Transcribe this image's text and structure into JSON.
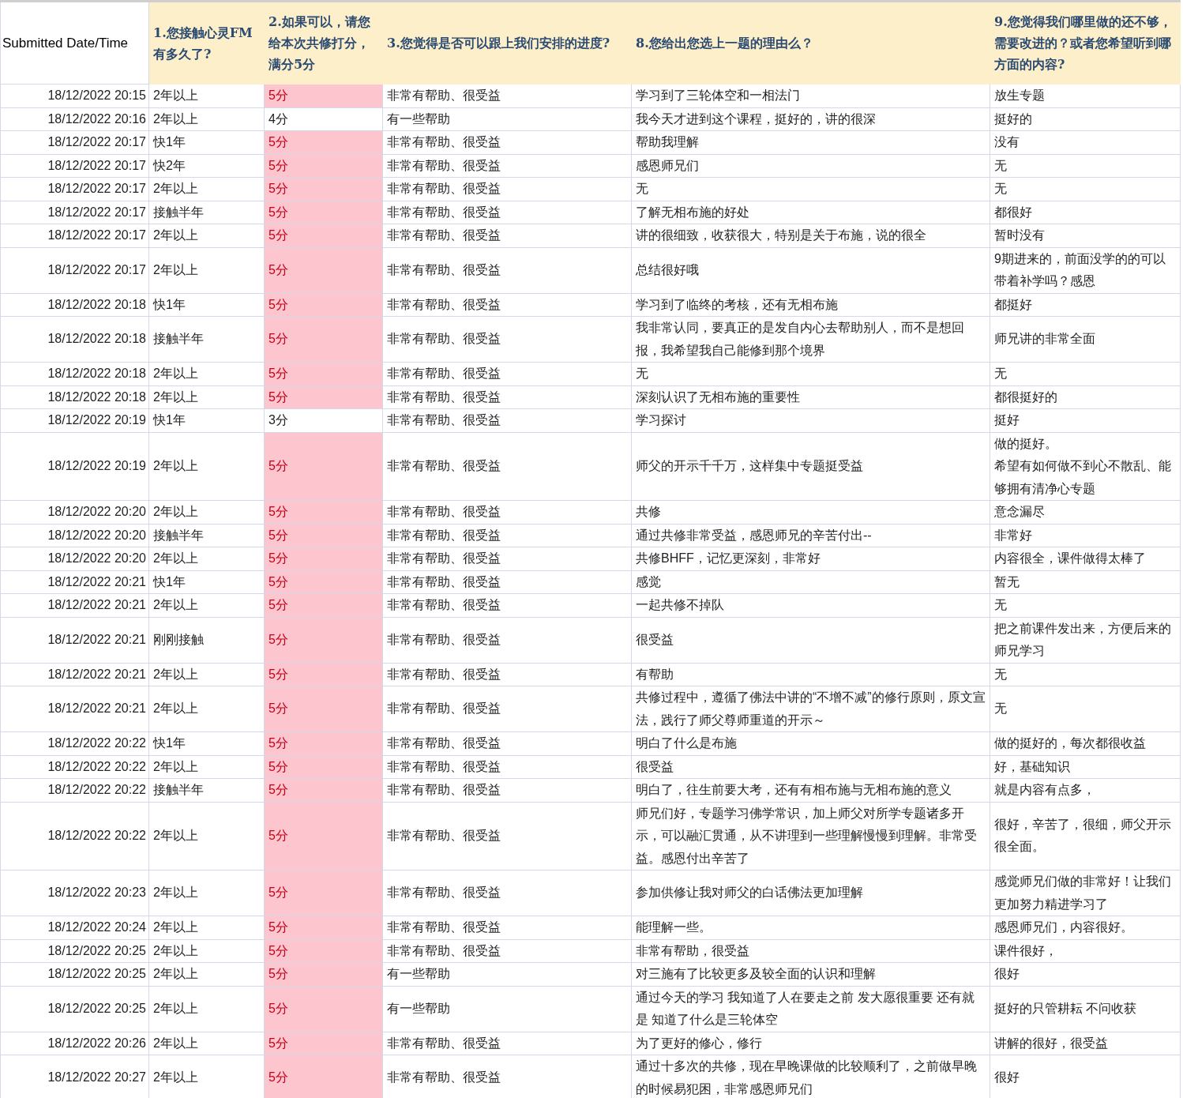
{
  "table": {
    "columns": [
      "Submitted Date/Time",
      "1.您接触心灵FM有多久了?",
      "2.如果可以，请您给本次共修打分，满分5分",
      "3.您觉得是否可以跟上我们安排的进度?",
      "8.您给出您选上一题的理由么？",
      "9.您觉得我们哪里做的还不够，需要改进的？或者您希望听到哪方面的内容?"
    ],
    "rows": [
      {
        "time": "18/12/2022 20:15",
        "duration": "2年以上",
        "score": "5分",
        "score_highlighted": true,
        "pace": "非常有帮助、很受益",
        "reason": "学习到了三轮体空和一相法门",
        "suggestion": "放生专题"
      },
      {
        "time": "18/12/2022 20:16",
        "duration": "2年以上",
        "score": "4分",
        "score_highlighted": false,
        "pace": "有一些帮助",
        "reason": "我今天才进到这个课程，挺好的，讲的很深",
        "suggestion": "挺好的"
      },
      {
        "time": "18/12/2022 20:17",
        "duration": "快1年",
        "score": "5分",
        "score_highlighted": true,
        "pace": "非常有帮助、很受益",
        "reason": "帮助我理解",
        "suggestion": "没有"
      },
      {
        "time": "18/12/2022 20:17",
        "duration": "快2年",
        "score": "5分",
        "score_highlighted": true,
        "pace": "非常有帮助、很受益",
        "reason": "感恩师兄们",
        "suggestion": "无"
      },
      {
        "time": "18/12/2022 20:17",
        "duration": "2年以上",
        "score": "5分",
        "score_highlighted": true,
        "pace": "非常有帮助、很受益",
        "reason": "无",
        "suggestion": "无"
      },
      {
        "time": "18/12/2022 20:17",
        "duration": "接触半年",
        "score": "5分",
        "score_highlighted": true,
        "pace": "非常有帮助、很受益",
        "reason": "了解无相布施的好处",
        "suggestion": "都很好"
      },
      {
        "time": "18/12/2022 20:17",
        "duration": "2年以上",
        "score": "5分",
        "score_highlighted": true,
        "pace": "非常有帮助、很受益",
        "reason": "讲的很细致，收获很大，特别是关于布施，说的很全",
        "suggestion": "暂时没有"
      },
      {
        "time": "18/12/2022 20:17",
        "duration": "2年以上",
        "score": "5分",
        "score_highlighted": true,
        "pace": "非常有帮助、很受益",
        "reason": "总结很好哦",
        "suggestion": "9期进来的，前面没学的的可以带着补学吗？感恩"
      },
      {
        "time": "18/12/2022 20:18",
        "duration": "快1年",
        "score": "5分",
        "score_highlighted": true,
        "pace": "非常有帮助、很受益",
        "reason": "学习到了临终的考核，还有无相布施",
        "suggestion": "都挺好"
      },
      {
        "time": "18/12/2022 20:18",
        "duration": "接触半年",
        "score": "5分",
        "score_highlighted": true,
        "pace": "非常有帮助、很受益",
        "reason": "我非常认同，要真正的是发自内心去帮助别人，而不是想回报，我希望我自己能修到那个境界",
        "suggestion": "师兄讲的非常全面"
      },
      {
        "time": "18/12/2022 20:18",
        "duration": "2年以上",
        "score": "5分",
        "score_highlighted": true,
        "pace": "非常有帮助、很受益",
        "reason": "无",
        "suggestion": "无"
      },
      {
        "time": "18/12/2022 20:18",
        "duration": "2年以上",
        "score": "5分",
        "score_highlighted": true,
        "pace": "非常有帮助、很受益",
        "reason": "深刻认识了无相布施的重要性",
        "suggestion": "都很挺好的"
      },
      {
        "time": "18/12/2022 20:19",
        "duration": "快1年",
        "score": "3分",
        "score_highlighted": false,
        "pace": "非常有帮助、很受益",
        "reason": "学习探讨",
        "suggestion": "挺好"
      },
      {
        "time": "18/12/2022 20:19",
        "duration": "2年以上",
        "score": "5分",
        "score_highlighted": true,
        "pace": "非常有帮助、很受益",
        "reason": "师父的开示千千万，这样集中专题挺受益",
        "suggestion": [
          "做的挺好。",
          "希望有如何做不到心不散乱、能够拥有清净心专题"
        ]
      },
      {
        "time": "18/12/2022 20:20",
        "duration": "2年以上",
        "score": "5分",
        "score_highlighted": true,
        "pace": "非常有帮助、很受益",
        "reason": "共修",
        "suggestion": "意念漏尽"
      },
      {
        "time": "18/12/2022 20:20",
        "duration": "接触半年",
        "score": "5分",
        "score_highlighted": true,
        "pace": "非常有帮助、很受益",
        "reason": "通过共修非常受益，感恩师兄的辛苦付出--",
        "suggestion": "非常好"
      },
      {
        "time": "18/12/2022 20:20",
        "duration": "2年以上",
        "score": "5分",
        "score_highlighted": true,
        "pace": "非常有帮助、很受益",
        "reason": "共修BHFF，记忆更深刻，非常好",
        "suggestion": "内容很全，课件做得太棒了"
      },
      {
        "time": "18/12/2022 20:21",
        "duration": "快1年",
        "score": "5分",
        "score_highlighted": true,
        "pace": "非常有帮助、很受益",
        "reason": "感觉",
        "suggestion": "暂无"
      },
      {
        "time": "18/12/2022 20:21",
        "duration": "2年以上",
        "score": "5分",
        "score_highlighted": true,
        "pace": "非常有帮助、很受益",
        "reason": "一起共修不掉队",
        "suggestion": "无"
      },
      {
        "time": "18/12/2022 20:21",
        "duration": "刚刚接触",
        "score": "5分",
        "score_highlighted": true,
        "pace": "非常有帮助、很受益",
        "reason": "很受益",
        "suggestion": "把之前课件发出来，方便后来的师兄学习"
      },
      {
        "time": "18/12/2022 20:21",
        "duration": "2年以上",
        "score": "5分",
        "score_highlighted": true,
        "pace": "非常有帮助、很受益",
        "reason": "有帮助",
        "suggestion": "无"
      },
      {
        "time": "18/12/2022 20:21",
        "duration": "2年以上",
        "score": "5分",
        "score_highlighted": true,
        "pace": "非常有帮助、很受益",
        "reason": "共修过程中，遵循了佛法中讲的“不增不减”的修行原则，原文宣法，践行了师父尊师重道的开示～",
        "suggestion": "无"
      },
      {
        "time": "18/12/2022 20:22",
        "duration": "快1年",
        "score": "5分",
        "score_highlighted": true,
        "pace": "非常有帮助、很受益",
        "reason": "明白了什么是布施",
        "suggestion": "做的挺好的，每次都很收益"
      },
      {
        "time": "18/12/2022 20:22",
        "duration": "2年以上",
        "score": "5分",
        "score_highlighted": true,
        "pace": "非常有帮助、很受益",
        "reason": "很受益",
        "suggestion": "好，基础知识"
      },
      {
        "time": "18/12/2022 20:22",
        "duration": "接触半年",
        "score": "5分",
        "score_highlighted": true,
        "pace": "非常有帮助、很受益",
        "reason": "明白了，往生前要大考，还有有相布施与无相布施的意义",
        "suggestion": "就是内容有点多，"
      },
      {
        "time": "18/12/2022 20:22",
        "duration": "2年以上",
        "score": "5分",
        "score_highlighted": true,
        "pace": "非常有帮助、很受益",
        "reason": "师兄们好，专题学习佛学常识，加上师父对所学专题诸多开示，可以融汇贯通，从不讲理到一些理解慢慢到理解。非常受益。感恩付出辛苦了",
        "suggestion": "很好，辛苦了，很细，师父开示很全面。"
      },
      {
        "time": "18/12/2022 20:23",
        "duration": "2年以上",
        "score": "5分",
        "score_highlighted": true,
        "pace": "非常有帮助、很受益",
        "reason": "参加供修让我对师父的白话佛法更加理解",
        "suggestion": "感觉师兄们做的非常好！让我们更加努力精进学习了"
      },
      {
        "time": "18/12/2022 20:24",
        "duration": "2年以上",
        "score": "5分",
        "score_highlighted": true,
        "pace": "非常有帮助、很受益",
        "reason": "能理解一些。",
        "suggestion": "感恩师兄们，内容很好。"
      },
      {
        "time": "18/12/2022 20:25",
        "duration": "2年以上",
        "score": "5分",
        "score_highlighted": true,
        "pace": "非常有帮助、很受益",
        "reason": "非常有帮助，很受益",
        "suggestion": "课件很好，"
      },
      {
        "time": "18/12/2022 20:25",
        "duration": "2年以上",
        "score": "5分",
        "score_highlighted": true,
        "pace": "有一些帮助",
        "reason": "对三施有了比较更多及较全面的认识和理解",
        "suggestion": "很好"
      },
      {
        "time": "18/12/2022 20:25",
        "duration": "2年以上",
        "score": "5分",
        "score_highlighted": true,
        "pace": "有一些帮助",
        "reason": "通过今天的学习 我知道了人在要走之前 发大愿很重要 还有就是 知道了什么是三轮体空",
        "suggestion": "挺好的只管耕耘 不问收获"
      },
      {
        "time": "18/12/2022 20:26",
        "duration": "2年以上",
        "score": "5分",
        "score_highlighted": true,
        "pace": "非常有帮助、很受益",
        "reason": "为了更好的修心，修行",
        "suggestion": "讲解的很好，很受益"
      },
      {
        "time": "18/12/2022 20:27",
        "duration": "2年以上",
        "score": "5分",
        "score_highlighted": true,
        "pace": "非常有帮助、很受益",
        "reason": "通过十多次的共修，现在早晚课做的比较顺利了，之前做早晚的时候易犯困，非常感恩师兄们",
        "suggestion": "很好"
      }
    ]
  }
}
